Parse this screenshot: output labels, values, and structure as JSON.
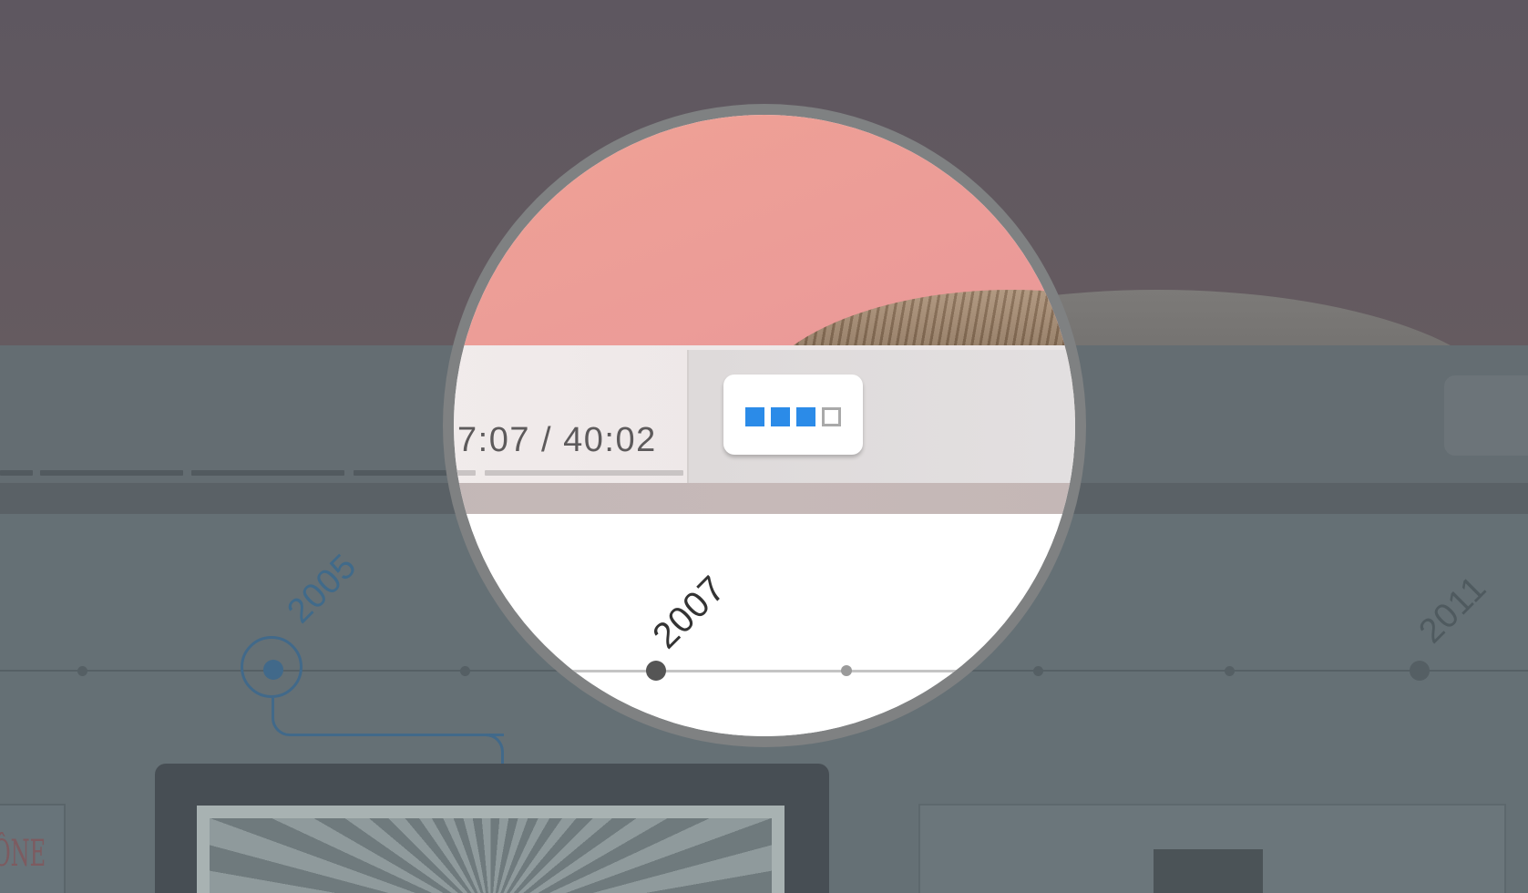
{
  "player": {
    "time_display": "7:07 / 40:02",
    "quality": {
      "label": "quality-level",
      "filled": 3,
      "total": 4,
      "accent_color": "#2b8be8"
    }
  },
  "timeline": {
    "years": [
      {
        "label": "2005",
        "state": "selected"
      },
      {
        "label": "2007",
        "state": "normal"
      },
      {
        "label": "2011",
        "state": "normal"
      }
    ],
    "selected_color": "#41698a"
  },
  "cards": {
    "left_partial_text": "ÔNE"
  }
}
